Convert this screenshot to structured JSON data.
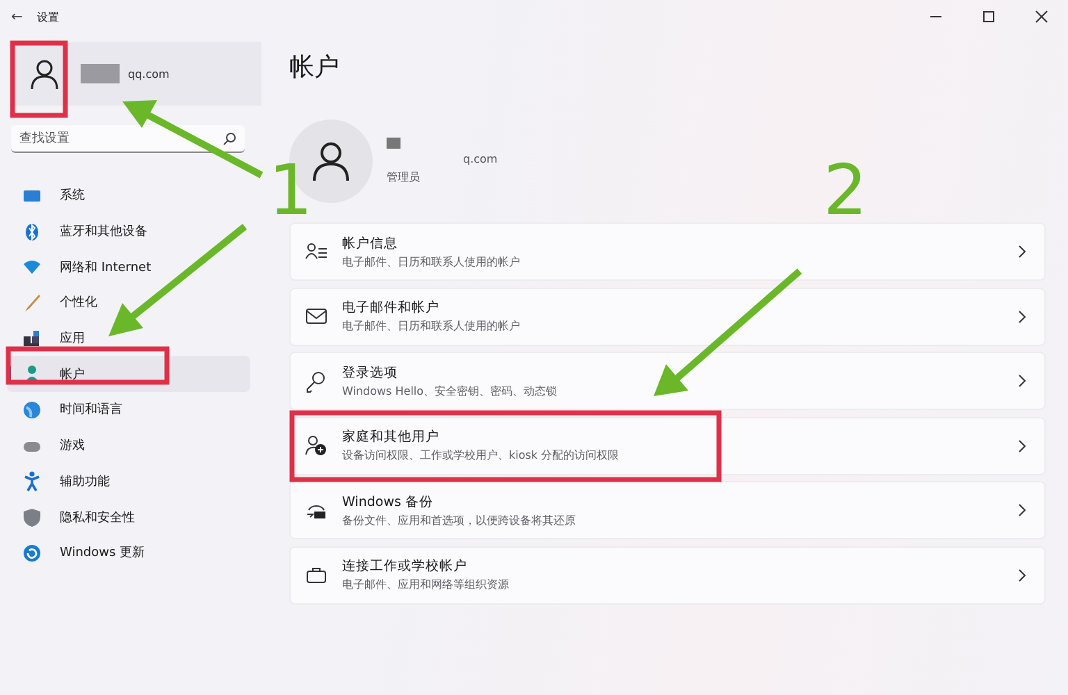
{
  "window": {
    "title": "设置",
    "back": "←"
  },
  "sidebar": {
    "profile": {
      "email": "qq.com"
    },
    "search": {
      "placeholder": "查找设置"
    },
    "items": [
      {
        "label": "系统",
        "selected": false
      },
      {
        "label": "蓝牙和其他设备",
        "selected": false
      },
      {
        "label": "网络和 Internet",
        "selected": false
      },
      {
        "label": "个性化",
        "selected": false
      },
      {
        "label": "应用",
        "selected": false
      },
      {
        "label": "帐户",
        "selected": true
      },
      {
        "label": "时间和语言",
        "selected": false
      },
      {
        "label": "游戏",
        "selected": false
      },
      {
        "label": "辅助功能",
        "selected": false
      },
      {
        "label": "隐私和安全性",
        "selected": false
      },
      {
        "label": "Windows 更新",
        "selected": false
      }
    ]
  },
  "page": {
    "title": "帐户",
    "user": {
      "email": "q.com",
      "role": "管理员"
    },
    "cards": [
      {
        "title": "帐户信息",
        "subtitle": "电子邮件、日历和联系人使用的帐户"
      },
      {
        "title": "电子邮件和帐户",
        "subtitle": "电子邮件、日历和联系人使用的帐户"
      },
      {
        "title": "登录选项",
        "subtitle": "Windows Hello、安全密钥、密码、动态锁"
      },
      {
        "title": "家庭和其他用户",
        "subtitle": "设备访问权限、工作或学校用户、kiosk 分配的访问权限"
      },
      {
        "title": "Windows 备份",
        "subtitle": "备份文件、应用和首选项，以便跨设备将其还原"
      },
      {
        "title": "连接工作或学校帐户",
        "subtitle": "电子邮件、应用和网络等组织资源"
      }
    ]
  },
  "annotations": [
    {
      "label": "1"
    },
    {
      "label": "2"
    }
  ]
}
